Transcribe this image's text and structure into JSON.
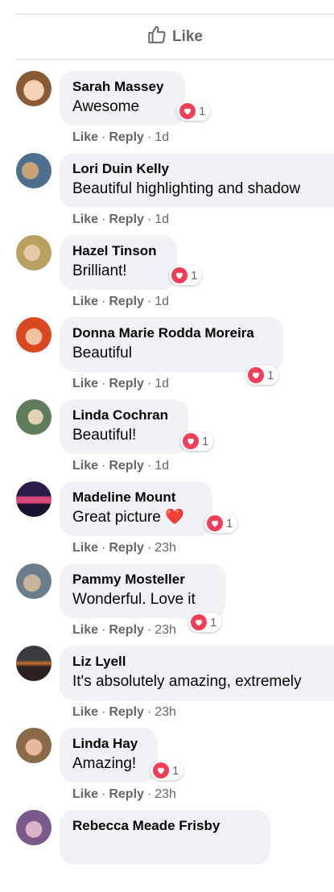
{
  "like_bar": {
    "label": "Like"
  },
  "actions": {
    "like": "Like",
    "reply": "Reply",
    "separator": "·"
  },
  "reaction_icon": "heart-icon",
  "colors": {
    "bubble": "#f0f2f5",
    "heart": "#f33e58",
    "meta": "#65676b"
  },
  "comments": [
    {
      "name": "Sarah Massey",
      "text": "Awesome",
      "time": "1d",
      "reactions": "1"
    },
    {
      "name": "Lori Duin Kelly",
      "text": "Beautiful highlighting and shadow",
      "time": "1d",
      "reactions": ""
    },
    {
      "name": "Hazel Tinson",
      "text": "Brilliant!",
      "time": "1d",
      "reactions": "1"
    },
    {
      "name": "Donna Marie Rodda Moreira",
      "text": "Beautiful",
      "time": "1d",
      "reactions": "1"
    },
    {
      "name": "Linda Cochran",
      "text": "Beautiful!",
      "time": "1d",
      "reactions": "1"
    },
    {
      "name": "Madeline Mount",
      "text": "Great picture",
      "emoji": "❤️",
      "time": "23h",
      "reactions": "1"
    },
    {
      "name": "Pammy Mosteller",
      "text": "Wonderful. Love it",
      "time": "23h",
      "reactions": "1"
    },
    {
      "name": "Liz Lyell",
      "text": "It's absolutely amazing, extremely",
      "time": "23h",
      "reactions": ""
    },
    {
      "name": "Linda Hay",
      "text": "Amazing!",
      "time": "23h",
      "reactions": "1"
    },
    {
      "name": "Rebecca Meade Frisby",
      "text": "",
      "time": "",
      "reactions": ""
    }
  ]
}
